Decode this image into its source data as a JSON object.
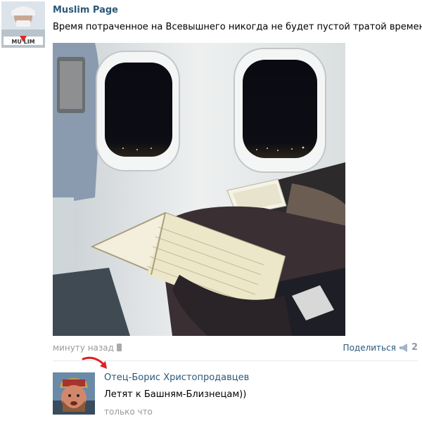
{
  "post": {
    "author": "Muslim Page",
    "text": "Время потраченное на Всевышнего никогда не будет пустой тратой времени",
    "avatar_text": "MU    LIM",
    "time": "минуту назад",
    "share_label": "Поделиться",
    "share_count": "2"
  },
  "comment": {
    "author": "Отец-Борис Христопродавцев",
    "text": "Летят к Башням-Близнецам))",
    "time": "только что"
  },
  "colors": {
    "link": "#2b587a",
    "muted": "#999999",
    "arrow": "#e02020"
  }
}
